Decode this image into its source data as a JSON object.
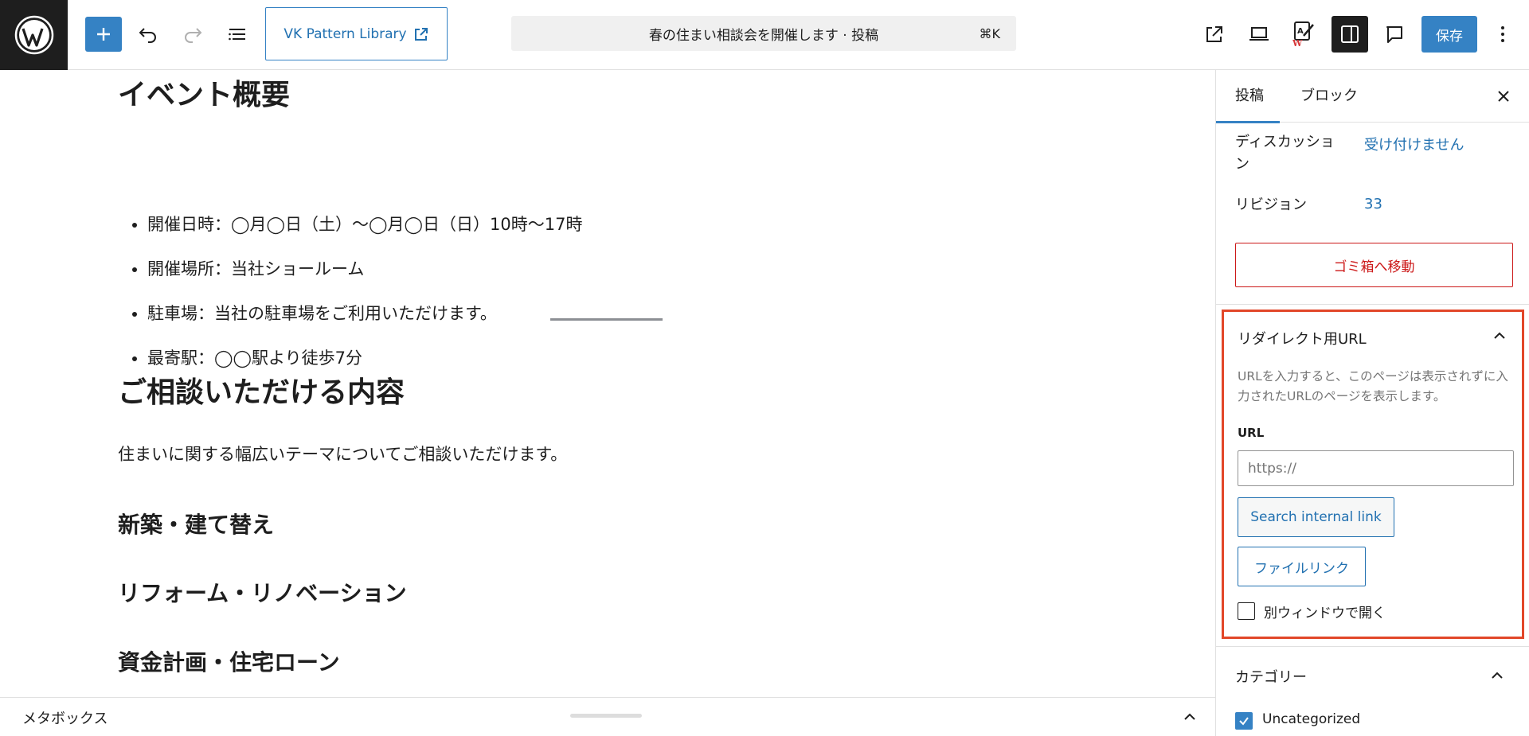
{
  "toolbar": {
    "pattern_library_label": "VK Pattern Library",
    "document_title": "春の住まい相談会を開催します · 投稿",
    "shortcut": "⌘K",
    "save_label": "保存"
  },
  "content": {
    "heading_event": "イベント概要",
    "bullets": [
      "開催日時：◯月◯日（土）〜◯月◯日（日）10時〜17時",
      "開催場所：当社ショールーム",
      "駐車場：当社の駐車場をご利用いただけます。",
      "最寄駅：◯◯駅より徒歩7分"
    ],
    "heading_consult": "ご相談いただける内容",
    "paragraph": "住まいに関する幅広いテーマについてご相談いただけます。",
    "subheadings": [
      "新築・建て替え",
      "リフォーム・リノベーション",
      "資金計画・住宅ローン"
    ]
  },
  "metabox": {
    "label": "メタボックス"
  },
  "sidebar": {
    "tabs": [
      "投稿",
      "ブロック"
    ],
    "discussion_label": "ディスカッショ\nン",
    "discussion_value": "受け付けません",
    "revision_label": "リビジョン",
    "revision_value": "33",
    "trash_label": "ゴミ箱へ移動",
    "redirect": {
      "title": "リダイレクト用URL",
      "description": "URLを入力すると、このページは表示されずに入力されたURLのページを表示します。",
      "url_label": "URL",
      "url_placeholder": "https://",
      "search_button": "Search internal link",
      "file_button": "ファイルリンク",
      "new_window_label": "別ウィンドウで開く"
    },
    "category": {
      "title": "カテゴリー",
      "items": [
        {
          "label": "Uncategorized",
          "checked": true
        }
      ]
    }
  },
  "colors": {
    "accent": "#3582c4",
    "link": "#2271b1",
    "danger": "#cc1818",
    "highlight": "#e24729"
  }
}
